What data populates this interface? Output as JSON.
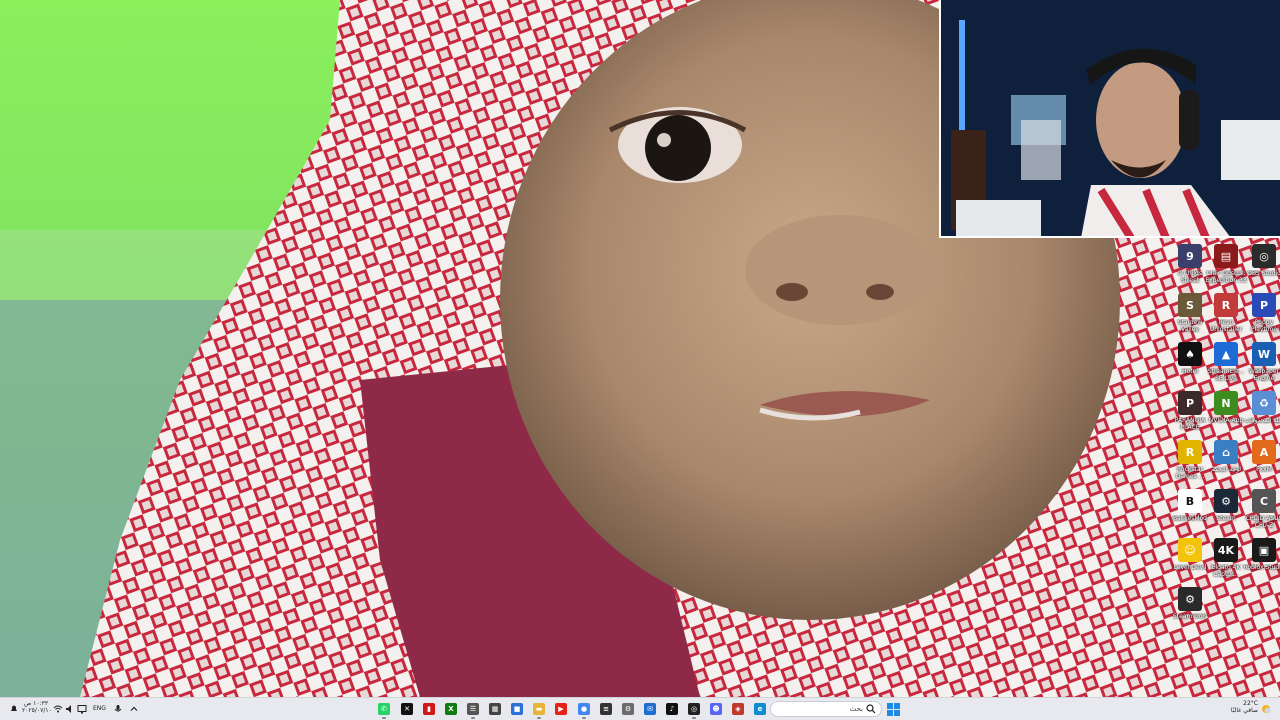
{
  "desktop": {
    "icons": [
      {
        "name": "9 Childs Street",
        "label": "9 Childs Street",
        "icon": "game-icon",
        "color": "#3b3f6b",
        "glyph": "9"
      },
      {
        "name": "Chants of Sennaar / Expedition 33",
        "label": "Clair Obscur: Expedition 33",
        "icon": "archive-icon",
        "color": "#8b1a1a",
        "glyph": "▤"
      },
      {
        "name": "OBS Studio",
        "label": "OBS Studio",
        "icon": "obs-icon",
        "color": "#2b2b2b",
        "glyph": "◎"
      },
      {
        "name": "Stardew",
        "label": "Stardew Valley",
        "icon": "game-icon",
        "color": "#6b5a3a",
        "glyph": "S"
      },
      {
        "name": "Revo Uninstaller",
        "label": "Revo Uninstaller",
        "icon": "uninstaller-icon",
        "color": "#c23b3b",
        "glyph": "R"
      },
      {
        "name": "Poppy Playtime",
        "label": "Poppy Playtime",
        "icon": "game-icon",
        "color": "#2a4ab8",
        "glyph": "P"
      },
      {
        "name": "Hotel",
        "label": "Hotel",
        "icon": "game-icon",
        "color": "#111111",
        "glyph": "♠"
      },
      {
        "name": "StreamElements SE.Live",
        "label": "StreamEle... SE.Live",
        "icon": "streamelements-icon",
        "color": "#1e6bd6",
        "glyph": "▲"
      },
      {
        "name": "Wallpaper Engine",
        "label": "Wallpaper Engine",
        "icon": "wallpaper-engine-icon",
        "color": "#1a5fb4",
        "glyph": "W"
      },
      {
        "name": "PARANOIA PLACE",
        "label": "PARANOIA PLACE",
        "icon": "game-icon",
        "color": "#3a2a2a",
        "glyph": "P"
      },
      {
        "name": "NVIDIA App",
        "label": "NVIDIA App",
        "icon": "nvidia-icon",
        "color": "#3c8c1f",
        "glyph": "N"
      },
      {
        "name": "Recycle Bin",
        "label": "سلة المحذوفات",
        "icon": "recycle-bin-icon",
        "color": "#5a8fd6",
        "glyph": "♻"
      },
      {
        "name": "Rockstar Games",
        "label": "Rockstar Games ...",
        "icon": "rockstar-icon",
        "color": "#e0b400",
        "glyph": "R"
      },
      {
        "name": "Control Panel",
        "label": "لوحة التحكم",
        "icon": "control-panel-icon",
        "color": "#3a7fc1",
        "glyph": "⌂"
      },
      {
        "name": "FxxM",
        "label": "FxxM",
        "icon": "app-icon",
        "color": "#e26a1b",
        "glyph": "A"
      },
      {
        "name": "BakkesMod",
        "label": "BakkesMod",
        "icon": "bakkesmod-icon",
        "color": "#ffffff",
        "glyph": "B"
      },
      {
        "name": "Steam",
        "label": "Steam",
        "icon": "steam-icon",
        "color": "#1b2838",
        "glyph": "⚙"
      },
      {
        "name": "CPUID ASUS CPU-Z",
        "label": "CPUID ASUS CPU-Z",
        "icon": "cpuz-icon",
        "color": "#555555",
        "glyph": "C"
      },
      {
        "name": "Level Devil",
        "label": "Level Devil",
        "icon": "game-icon",
        "color": "#f2c40c",
        "glyph": "☺"
      },
      {
        "name": "Elgato 4K Capture",
        "label": "Elgato 4K Captur...",
        "icon": "elgato-icon",
        "color": "#1a1a1a",
        "glyph": "4K"
      },
      {
        "name": "Roblox Studio",
        "label": "Roblox Studio",
        "icon": "roblox-icon",
        "color": "#1a1a1a",
        "glyph": "▣"
      },
      {
        "name": "SteamTools",
        "label": "SteamTools",
        "icon": "steamtools-icon",
        "color": "#2a2a2a",
        "glyph": "⚙"
      }
    ]
  },
  "taskbar": {
    "clock_time": "١٠:٣٣ ص",
    "clock_date": "٢٠٢٥/٠٧/١٠",
    "language": "ENG",
    "search_placeholder": "بحث",
    "weather_temp": "22°C",
    "weather_text": "صافي غالبًا",
    "apps": [
      {
        "name": "whatsapp",
        "icon": "whatsapp-icon",
        "color": "#25d366",
        "glyph": "✆"
      },
      {
        "name": "capcut",
        "icon": "capcut-icon",
        "color": "#111111",
        "glyph": "✕"
      },
      {
        "name": "red-app",
        "icon": "app-icon",
        "color": "#d01818",
        "glyph": "▮"
      },
      {
        "name": "xbox",
        "icon": "xbox-icon",
        "color": "#107c10",
        "glyph": "X"
      },
      {
        "name": "files",
        "icon": "files-icon",
        "color": "#555555",
        "glyph": "☰"
      },
      {
        "name": "settings-app",
        "icon": "calculator-icon",
        "color": "#444444",
        "glyph": "▦"
      },
      {
        "name": "store",
        "icon": "store-icon",
        "color": "#2e6fd9",
        "glyph": "■"
      },
      {
        "name": "explorer",
        "icon": "folder-icon",
        "color": "#e8b33a",
        "glyph": "▬"
      },
      {
        "name": "youtube",
        "icon": "youtube-icon",
        "color": "#e62117",
        "glyph": "▶"
      },
      {
        "name": "chrome",
        "icon": "chrome-icon",
        "color": "#4285f4",
        "glyph": "●"
      },
      {
        "name": "task-manager",
        "icon": "task-manager-icon",
        "color": "#333333",
        "glyph": "≡"
      },
      {
        "name": "settings",
        "icon": "gear-icon",
        "color": "#6b6b6b",
        "glyph": "⚙"
      },
      {
        "name": "mail",
        "icon": "mail-icon",
        "color": "#1f6fd0",
        "glyph": "✉"
      },
      {
        "name": "tiktok",
        "icon": "tiktok-icon",
        "color": "#111111",
        "glyph": "♪"
      },
      {
        "name": "obs",
        "icon": "obs-icon",
        "color": "#222222",
        "glyph": "◎"
      },
      {
        "name": "discord",
        "icon": "discord-icon",
        "color": "#5865f2",
        "glyph": "☻"
      },
      {
        "name": "vpn",
        "icon": "shield-icon",
        "color": "#c0392b",
        "glyph": "◈"
      },
      {
        "name": "edge",
        "icon": "edge-icon",
        "color": "#0f8dcf",
        "glyph": "e"
      }
    ]
  },
  "colors": {
    "taskbar_bg": "#e7e9ee",
    "ghutra_red": "#c0283c",
    "green_screen": "#86e85a"
  }
}
